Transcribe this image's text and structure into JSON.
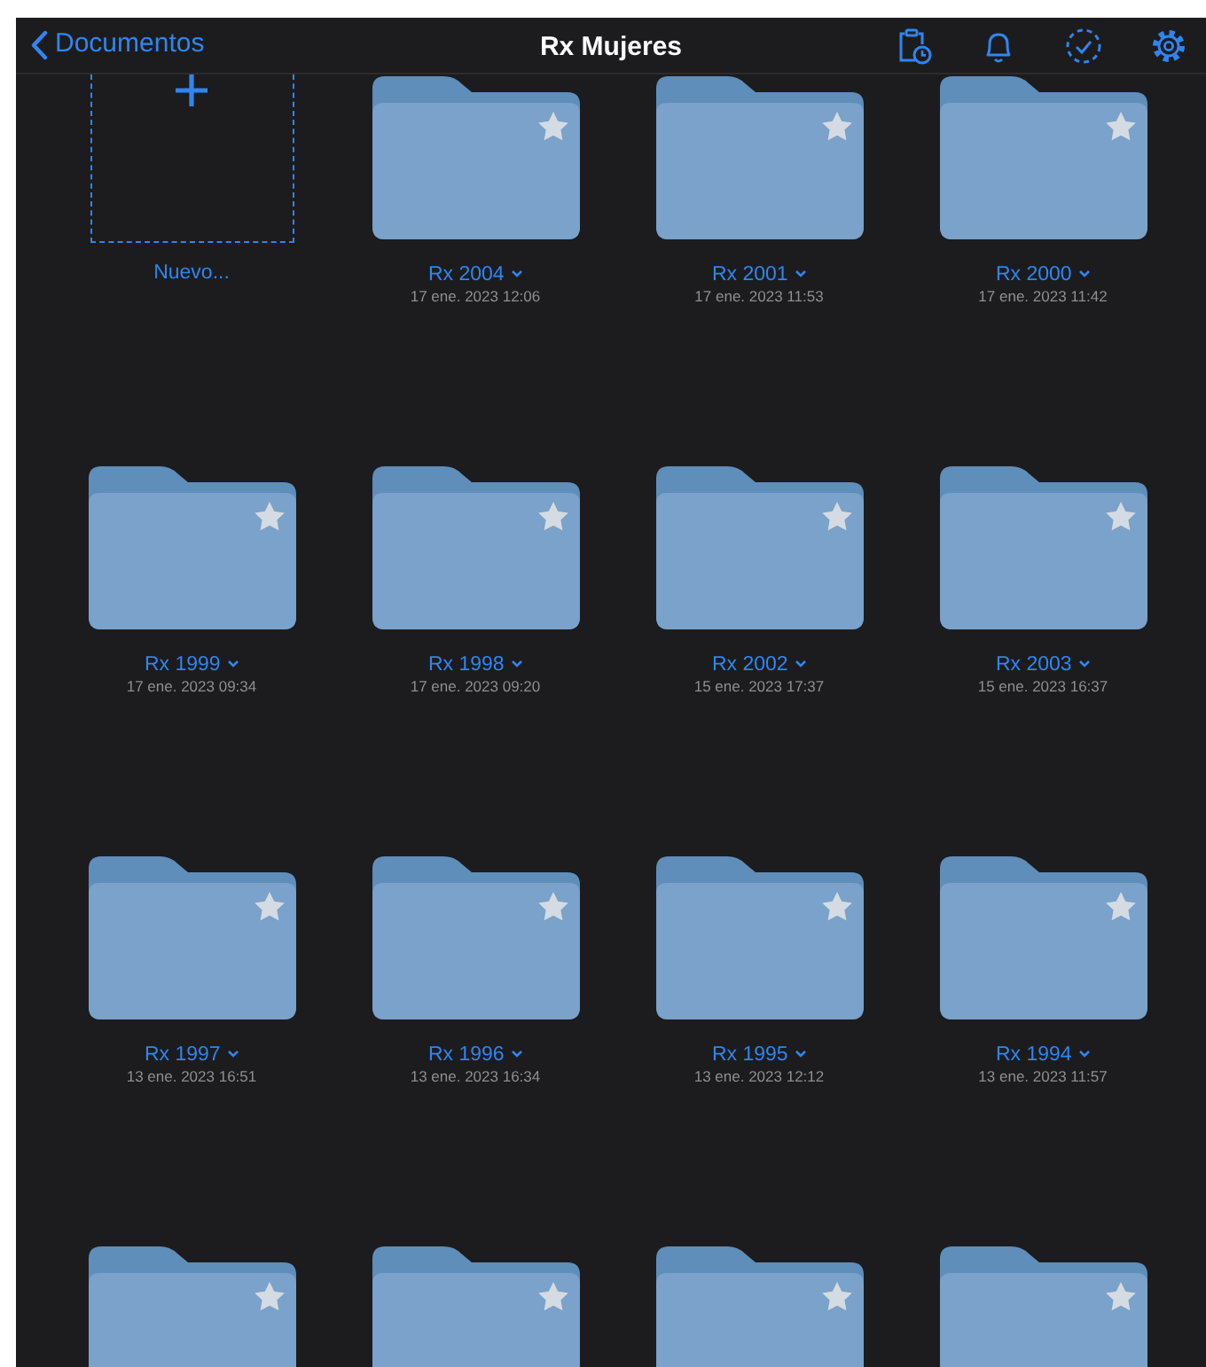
{
  "nav": {
    "back": "Documentos",
    "title": "Rx Mujeres"
  },
  "items": [
    {
      "kind": "new",
      "name": "Nuevo..."
    },
    {
      "kind": "folder",
      "name": "Rx 2004",
      "date": "17 ene. 2023 12:06"
    },
    {
      "kind": "folder",
      "name": "Rx 2001",
      "date": "17 ene. 2023 11:53"
    },
    {
      "kind": "folder",
      "name": "Rx 2000",
      "date": "17 ene. 2023 11:42"
    },
    {
      "kind": "folder",
      "name": "Rx 1999",
      "date": "17 ene. 2023 09:34"
    },
    {
      "kind": "folder",
      "name": "Rx 1998",
      "date": "17 ene. 2023 09:20"
    },
    {
      "kind": "folder",
      "name": "Rx 2002",
      "date": "15 ene. 2023 17:37"
    },
    {
      "kind": "folder",
      "name": "Rx 2003",
      "date": "15 ene. 2023 16:37"
    },
    {
      "kind": "folder",
      "name": "Rx 1997",
      "date": "13 ene. 2023 16:51"
    },
    {
      "kind": "folder",
      "name": "Rx 1996",
      "date": "13 ene. 2023 16:34"
    },
    {
      "kind": "folder",
      "name": "Rx 1995",
      "date": "13 ene. 2023 12:12"
    },
    {
      "kind": "folder",
      "name": "Rx 1994",
      "date": "13 ene. 2023 11:57"
    },
    {
      "kind": "folder"
    },
    {
      "kind": "folder"
    },
    {
      "kind": "folder"
    },
    {
      "kind": "folder"
    }
  ]
}
